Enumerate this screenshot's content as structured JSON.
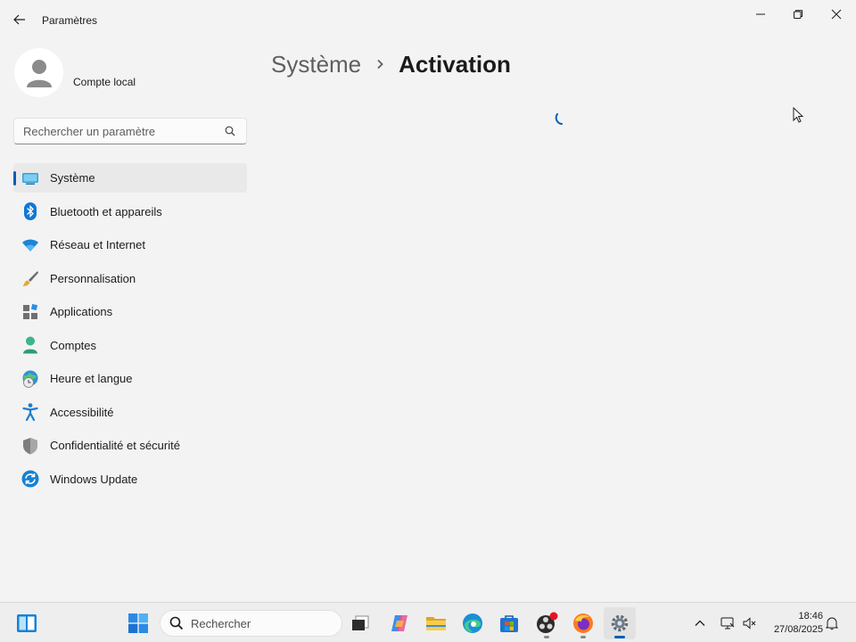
{
  "window": {
    "title": "Paramètres",
    "controls": [
      "minimize",
      "maximize",
      "close"
    ]
  },
  "account": {
    "name": "Compte local"
  },
  "search": {
    "placeholder": "Rechercher un paramètre"
  },
  "sidebar": {
    "items": [
      {
        "label": "Système",
        "icon": "system-icon",
        "active": true
      },
      {
        "label": "Bluetooth et appareils",
        "icon": "bluetooth-icon",
        "active": false
      },
      {
        "label": "Réseau et Internet",
        "icon": "wifi-icon",
        "active": false
      },
      {
        "label": "Personnalisation",
        "icon": "brush-icon",
        "active": false
      },
      {
        "label": "Applications",
        "icon": "apps-icon",
        "active": false
      },
      {
        "label": "Comptes",
        "icon": "person-icon",
        "active": false
      },
      {
        "label": "Heure et langue",
        "icon": "globe-clock-icon",
        "active": false
      },
      {
        "label": "Accessibilité",
        "icon": "accessibility-icon",
        "active": false
      },
      {
        "label": "Confidentialité et sécurité",
        "icon": "shield-icon",
        "active": false
      },
      {
        "label": "Windows Update",
        "icon": "update-icon",
        "active": false
      }
    ]
  },
  "header": {
    "parent": "Système",
    "current": "Activation"
  },
  "taskbar": {
    "search_label": "Rechercher",
    "apps": [
      "task-view",
      "copilot",
      "file-explorer",
      "edge",
      "store",
      "obs",
      "firefox",
      "settings"
    ],
    "time": "18:46",
    "date": "27/08/2025"
  },
  "colors": {
    "accent": "#005fb8",
    "background": "#f3f3f3",
    "active_item": "#e9e9e9"
  }
}
